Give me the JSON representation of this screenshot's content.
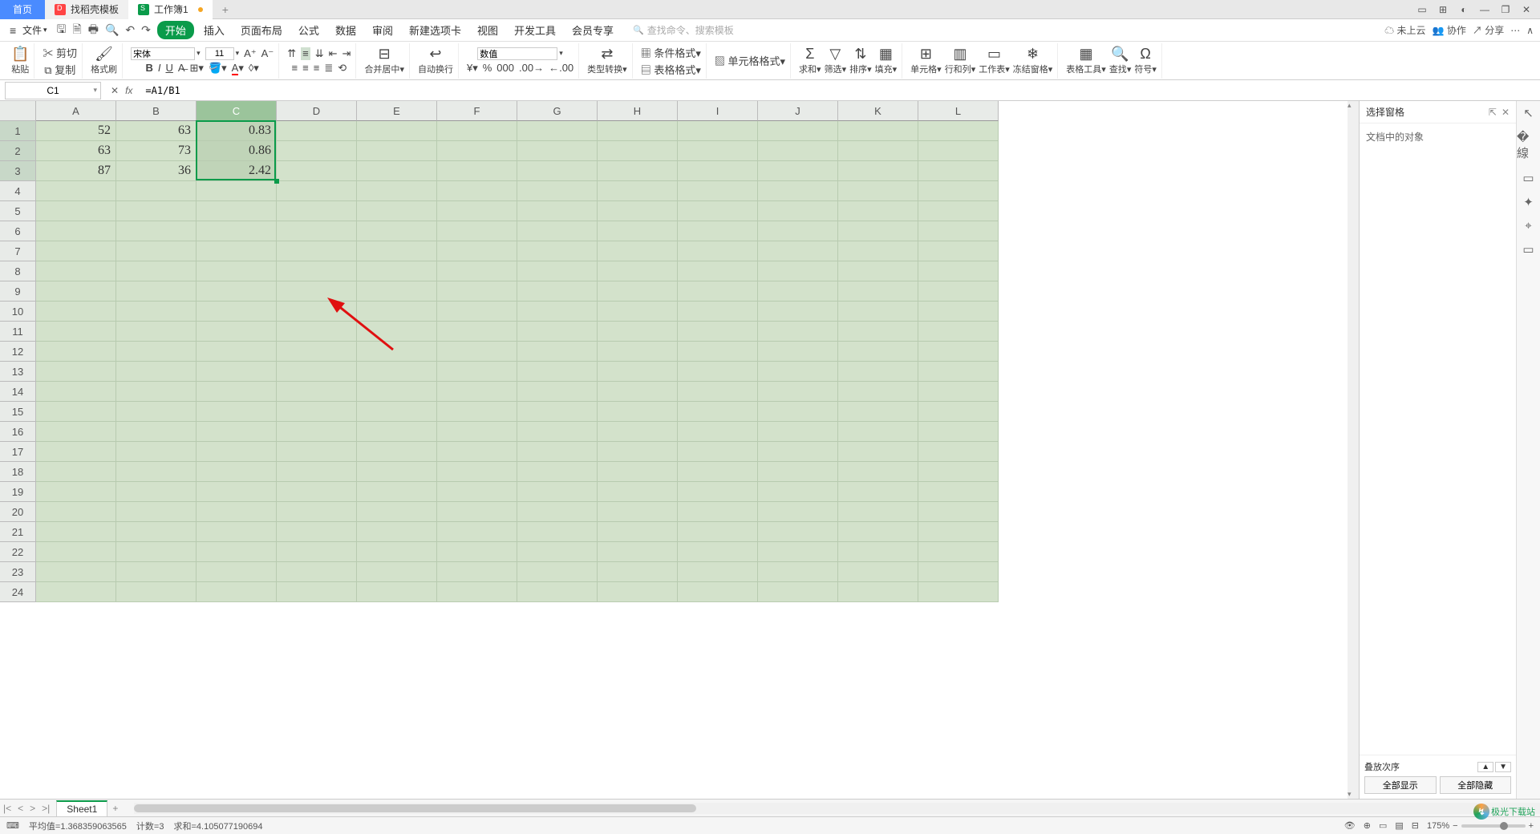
{
  "tabs": {
    "home": "首页",
    "t1": "找稻壳模板",
    "t2": "工作簿1"
  },
  "menu": {
    "file": "文件",
    "items": [
      "开始",
      "插入",
      "页面布局",
      "公式",
      "数据",
      "审阅",
      "新建选项卡",
      "视图",
      "开发工具",
      "会员专享"
    ],
    "search_ph": "查找命令、搜索模板"
  },
  "right_menu": {
    "cloud": "未上云",
    "coop": "协作",
    "share": "分享"
  },
  "ribbon": {
    "paste": "粘贴",
    "cut": "剪切",
    "copy": "复制",
    "brush": "格式刷",
    "font": "宋体",
    "size": "11",
    "merge": "合并居中",
    "wrap": "自动换行",
    "numfmt": "数值",
    "typecv": "类型转换",
    "condf": "条件格式",
    "tablef": "表格格式",
    "cellf": "单元格格式",
    "sum": "求和",
    "filter": "筛选",
    "sort": "排序",
    "fill": "填充",
    "cell": "单元格",
    "rowcol": "行和列",
    "ws": "工作表",
    "freeze": "冻结窗格",
    "tools": "表格工具",
    "find": "查找",
    "symbol": "符号"
  },
  "namebox": "C1",
  "formula": "=A1/B1",
  "columns": [
    "A",
    "B",
    "C",
    "D",
    "E",
    "F",
    "G",
    "H",
    "I",
    "J",
    "K",
    "L"
  ],
  "rows": 24,
  "cells": {
    "A1": "52",
    "B1": "63",
    "C1": "0.83",
    "A2": "63",
    "B2": "73",
    "C2": "0.86",
    "A3": "87",
    "B3": "36",
    "C3": "2.42"
  },
  "selection": {
    "col": "C",
    "r1": 1,
    "r2": 3
  },
  "panel": {
    "title": "选择窗格",
    "obj": "文档中的对象",
    "stack": "叠放次序",
    "showall": "全部显示",
    "hideall": "全部隐藏"
  },
  "sheets": {
    "s1": "Sheet1"
  },
  "status": {
    "avg_l": "平均值=",
    "avg": "1.368359063565",
    "cnt_l": "计数=",
    "cnt": "3",
    "sum_l": "求和=",
    "sum": "4.105077190694",
    "zoom": "175%"
  },
  "logo": "极光下载站"
}
